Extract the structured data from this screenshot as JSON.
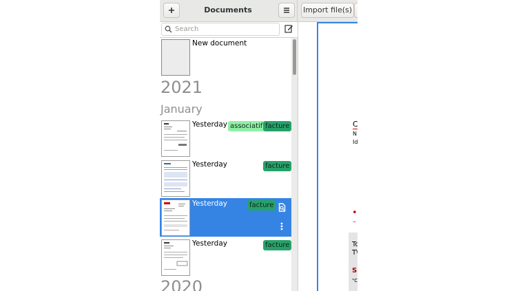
{
  "header": {
    "add_icon": "plus-icon",
    "title": "Documents",
    "menu_icon": "hamburger-menu-icon",
    "import_label": "Import file(s)"
  },
  "search": {
    "placeholder": "Search",
    "icon": "search-icon",
    "new_icon": "edit-document-icon"
  },
  "new_document": {
    "label": "New document"
  },
  "groups": [
    {
      "year": "2021",
      "month": "January",
      "documents": [
        {
          "date": "Yesterday",
          "tags": [
            {
              "label": "associatif",
              "color": "#8ff0a4"
            },
            {
              "label": "facture",
              "color": "#26a269"
            }
          ]
        },
        {
          "date": "Yesterday",
          "tags": [
            {
              "label": "facture",
              "color": "#26a269"
            }
          ]
        },
        {
          "date": "Yesterday",
          "selected": true,
          "tags": [
            {
              "label": "facture",
              "color": "#26a269"
            }
          ],
          "actions": [
            "open-document-icon",
            "more-options-icon"
          ]
        },
        {
          "date": "Yesterday",
          "tags": [
            {
              "label": "facture",
              "color": "#26a269"
            }
          ]
        }
      ]
    },
    {
      "year": "2020"
    }
  ],
  "preview": {
    "line1": "C",
    "line2": "N",
    "line3": "Id",
    "bullet": "•",
    "dash": "–",
    "box_line1": "Tc",
    "box_line2": "T\\",
    "box_red": "S",
    "box_quote": "\"C"
  },
  "colors": {
    "accent": "#3584e4",
    "tag_dark": "#26a269",
    "tag_light": "#8ff0a4"
  }
}
